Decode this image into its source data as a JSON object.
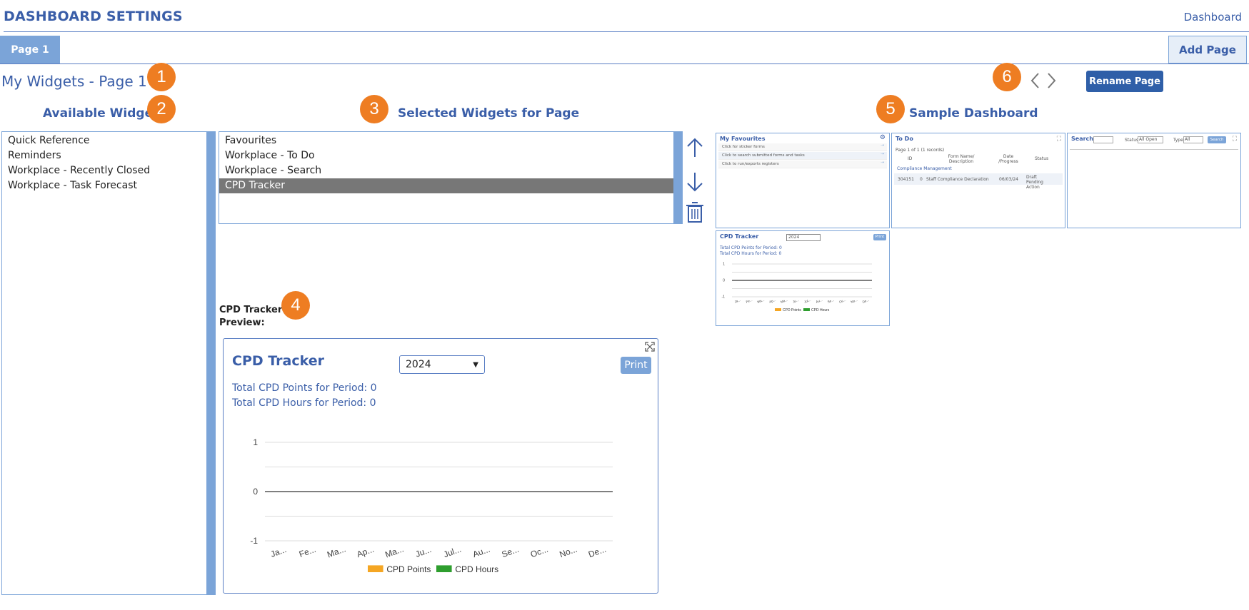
{
  "header": {
    "title": "DASHBOARD SETTINGS",
    "dashboard_link": "Dashboard"
  },
  "tabs": {
    "active": "Page 1",
    "add_page": "Add Page"
  },
  "page": {
    "title": "My Widgets - Page 1",
    "rename_button": "Rename Page"
  },
  "badges": [
    "1",
    "2",
    "3",
    "4",
    "5",
    "6"
  ],
  "available": {
    "title": "Available Widgets",
    "items": [
      "Quick Reference",
      "Reminders",
      "Workplace - Recently Closed",
      "Workplace - Task Forecast"
    ]
  },
  "selected": {
    "title": "Selected Widgets for Page",
    "items": [
      "Favourites",
      "Workplace - To Do",
      "Workplace - Search",
      "CPD Tracker"
    ],
    "selected_index": 3
  },
  "preview": {
    "label": "CPD Tracker Preview:",
    "widget_title": "CPD Tracker",
    "year": "2024",
    "print": "Print",
    "points_text": "Total CPD Points for Period: 0",
    "hours_text": "Total CPD Hours for Period: 0"
  },
  "sample": {
    "title": "Sample Dashboard",
    "favourites": {
      "title": "My Favourites",
      "rows": [
        "Click for sticker forms",
        "Click to search submitted forms and tasks",
        "Click to run/exports registers"
      ]
    },
    "todo": {
      "title": "To Do",
      "paging": "Page 1 of 1 (1 records)",
      "headers": [
        "ID",
        "Form Name/ Description",
        "Date /Progress",
        "Status"
      ],
      "group": "Compliance Management",
      "row": [
        "304151",
        "0",
        "Staff Compliance Declaration",
        "06/03/24",
        "Draft Pending Action"
      ]
    },
    "search": {
      "title": "Search",
      "status_label": "Status",
      "status_value": "All Open",
      "type_label": "Type",
      "type_value": "All",
      "button": "Search"
    },
    "cpd": {
      "title": "CPD Tracker",
      "year": "2024",
      "print": "Print",
      "points_text": "Total CPD Points for Period: 0",
      "hours_text": "Total CPD Hours for Period: 0",
      "legend": [
        "CPD Points",
        "CPD Hours"
      ]
    }
  },
  "colors": {
    "accent": "#3a5ea8",
    "badge": "#ee7d22",
    "points": "#f5a623",
    "hours": "#2e9e2e",
    "selected_row": "#777777"
  },
  "chart_data": {
    "type": "bar",
    "categories": [
      "Ja...",
      "Fe...",
      "Ma...",
      "Ap...",
      "Ma...",
      "Ju...",
      "Jul...",
      "Au...",
      "Se...",
      "Oc...",
      "No...",
      "De..."
    ],
    "series": [
      {
        "name": "CPD Points",
        "values": [
          0,
          0,
          0,
          0,
          0,
          0,
          0,
          0,
          0,
          0,
          0,
          0
        ]
      },
      {
        "name": "CPD Hours",
        "values": [
          0,
          0,
          0,
          0,
          0,
          0,
          0,
          0,
          0,
          0,
          0,
          0
        ]
      }
    ],
    "yticks": [
      "1",
      "0",
      "-1"
    ],
    "ylim": [
      -1,
      1
    ],
    "legend": "bottom"
  }
}
